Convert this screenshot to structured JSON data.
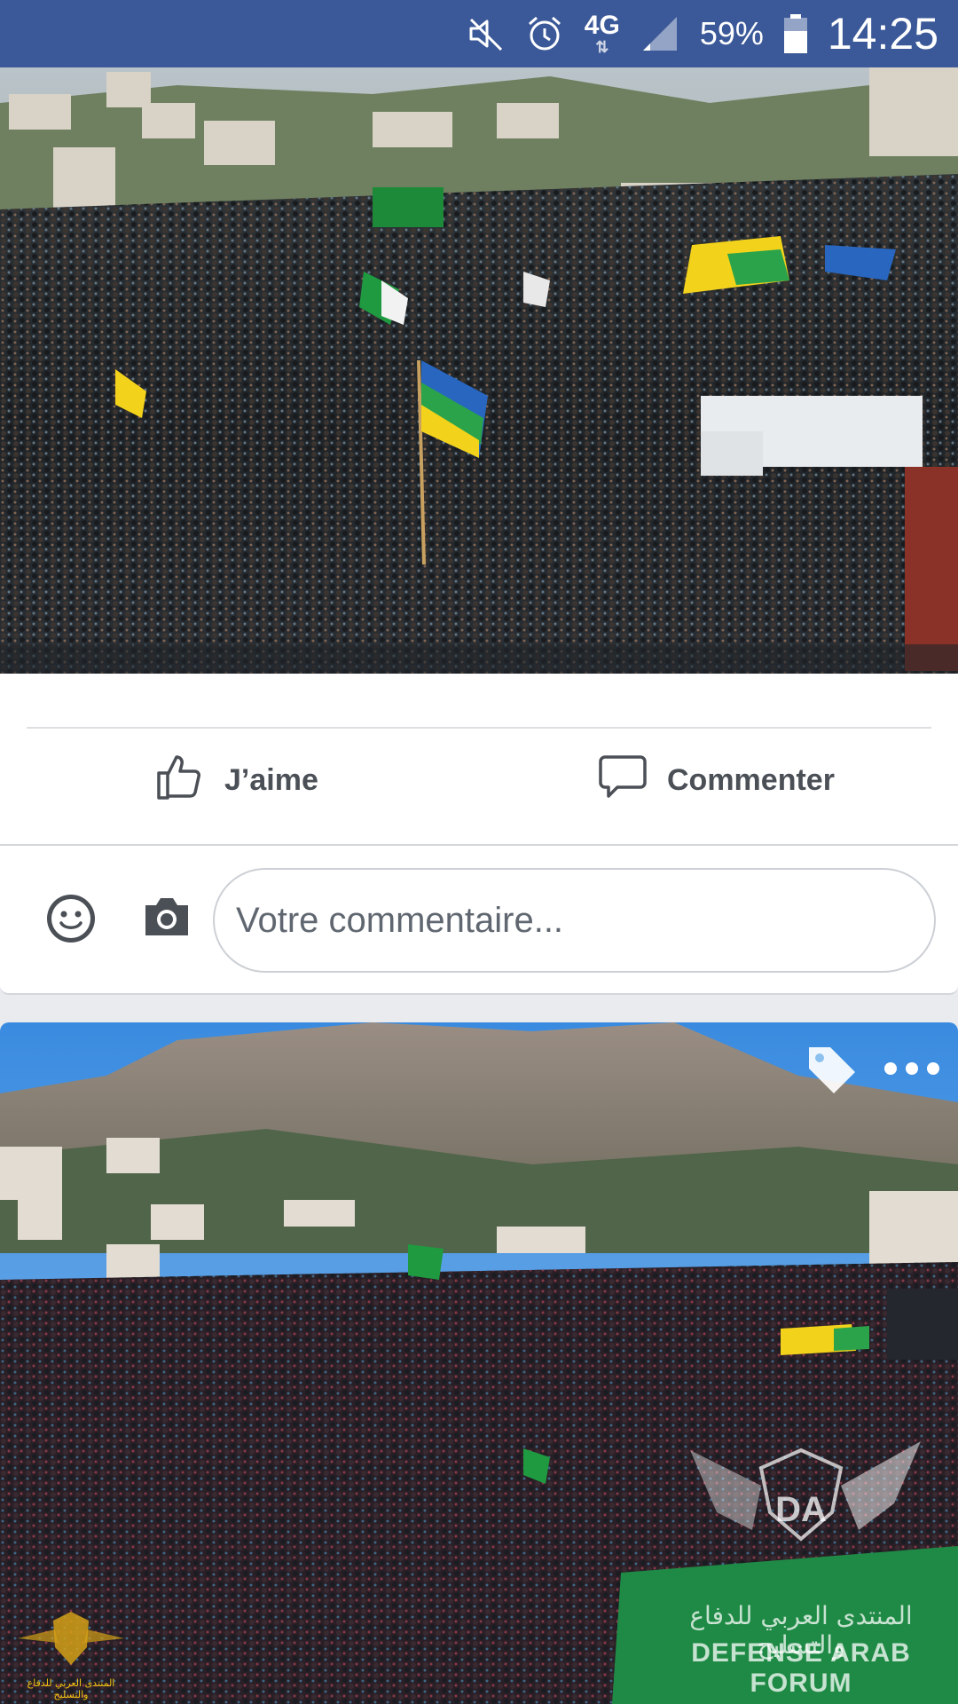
{
  "statusbar": {
    "icons": [
      "mute-icon",
      "alarm-icon",
      "network-4g-icon",
      "signal-icon",
      "battery-icon"
    ],
    "network_type": "4G",
    "network_arrows": "⇅",
    "battery_percent": "59%",
    "time": "14:25",
    "background": "#3b5998"
  },
  "post1": {
    "photo": "crowd-protest-photo",
    "actions": {
      "like_label": "J’aime",
      "comment_label": "Commenter"
    },
    "composer": {
      "placeholder": "Votre commentaire..."
    }
  },
  "post2": {
    "photo": "crowd-mountain-protest-photo",
    "tag_icon": "tag-icon",
    "more_icon": "more-options-icon",
    "watermark": {
      "arabic": "المنتدى العربي للدفاع والتسليح",
      "english": "DEFENSE ARAB FORUM",
      "logo_letters": "DA",
      "badge_text": "المنتدى العربي للدفاع والتسليح"
    }
  },
  "colors": {
    "facebook_blue": "#3b5998",
    "action_text": "#4b4f56",
    "divider": "#dddfe2"
  }
}
